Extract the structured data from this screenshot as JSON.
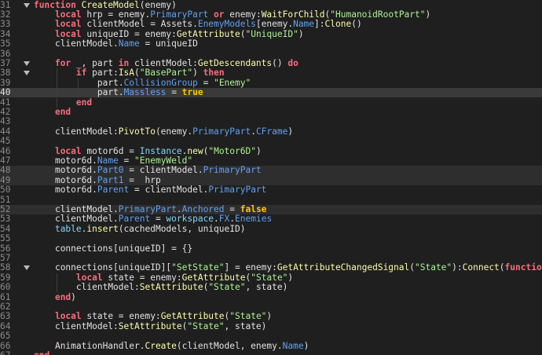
{
  "editor": {
    "lines": [
      {
        "num": "31",
        "fold": true,
        "state": "",
        "indent": 0,
        "tokens": [
          [
            "kw",
            "function"
          ],
          [
            "id",
            " "
          ],
          [
            "fn",
            "CreateModel"
          ],
          [
            "id",
            "(enemy)"
          ]
        ]
      },
      {
        "num": "32",
        "fold": false,
        "state": "",
        "indent": 1,
        "tokens": [
          [
            "kw",
            "local"
          ],
          [
            "id",
            " hrp = enemy."
          ],
          [
            "pr",
            "PrimaryPart"
          ],
          [
            "id",
            " "
          ],
          [
            "kw",
            "or"
          ],
          [
            "id",
            " enemy:"
          ],
          [
            "fn",
            "WaitForChild"
          ],
          [
            "id",
            "("
          ],
          [
            "st",
            "\"HumanoidRootPart\""
          ],
          [
            "id",
            ")"
          ]
        ]
      },
      {
        "num": "33",
        "fold": false,
        "state": "",
        "indent": 1,
        "tokens": [
          [
            "kw",
            "local"
          ],
          [
            "id",
            " clientModel = Assets."
          ],
          [
            "pr",
            "EnemyModels"
          ],
          [
            "id",
            "[enemy."
          ],
          [
            "pr",
            "Name"
          ],
          [
            "id",
            "]:"
          ],
          [
            "fn",
            "Clone"
          ],
          [
            "id",
            "()"
          ]
        ]
      },
      {
        "num": "34",
        "fold": false,
        "state": "",
        "indent": 1,
        "tokens": [
          [
            "kw",
            "local"
          ],
          [
            "id",
            " uniqueID = enemy:"
          ],
          [
            "fn",
            "GetAttribute"
          ],
          [
            "id",
            "("
          ],
          [
            "st",
            "\"UniqueID\""
          ],
          [
            "id",
            ")"
          ]
        ]
      },
      {
        "num": "35",
        "fold": false,
        "state": "",
        "indent": 1,
        "tokens": [
          [
            "id",
            "clientModel."
          ],
          [
            "pr",
            "Name"
          ],
          [
            "id",
            " = uniqueID"
          ]
        ]
      },
      {
        "num": "36",
        "fold": false,
        "state": "",
        "indent": 0,
        "tokens": []
      },
      {
        "num": "37",
        "fold": true,
        "state": "",
        "indent": 1,
        "tokens": [
          [
            "kw",
            "for"
          ],
          [
            "id",
            " _, part "
          ],
          [
            "kw",
            "in"
          ],
          [
            "id",
            " clientModel:"
          ],
          [
            "fn",
            "GetDescendants"
          ],
          [
            "id",
            "() "
          ],
          [
            "kw",
            "do"
          ]
        ]
      },
      {
        "num": "38",
        "fold": true,
        "state": "",
        "indent": 2,
        "tokens": [
          [
            "kw",
            "if"
          ],
          [
            "id",
            " part:"
          ],
          [
            "fn",
            "IsA"
          ],
          [
            "id",
            "("
          ],
          [
            "st",
            "\"BasePart\""
          ],
          [
            "id",
            ") "
          ],
          [
            "kw",
            "then"
          ]
        ]
      },
      {
        "num": "39",
        "fold": false,
        "state": "",
        "indent": 3,
        "tokens": [
          [
            "id",
            "part."
          ],
          [
            "pr",
            "CollisionGroup"
          ],
          [
            "id",
            " = "
          ],
          [
            "st",
            "\"Enemy\""
          ]
        ]
      },
      {
        "num": "40",
        "fold": false,
        "state": "cur",
        "indent": 3,
        "tokens": [
          [
            "id",
            "part."
          ],
          [
            "pr",
            "Massless"
          ],
          [
            "id",
            " = "
          ],
          [
            "bo",
            "true"
          ]
        ]
      },
      {
        "num": "41",
        "fold": false,
        "state": "",
        "indent": 2,
        "tokens": [
          [
            "kw",
            "end"
          ]
        ]
      },
      {
        "num": "42",
        "fold": false,
        "state": "",
        "indent": 1,
        "tokens": [
          [
            "kw",
            "end"
          ]
        ]
      },
      {
        "num": "43",
        "fold": false,
        "state": "",
        "indent": 0,
        "tokens": []
      },
      {
        "num": "44",
        "fold": false,
        "state": "",
        "indent": 1,
        "tokens": [
          [
            "id",
            "clientModel:"
          ],
          [
            "fn",
            "PivotTo"
          ],
          [
            "id",
            "(enemy."
          ],
          [
            "pr",
            "PrimaryPart"
          ],
          [
            "id",
            "."
          ],
          [
            "pr",
            "CFrame"
          ],
          [
            "id",
            ")"
          ]
        ]
      },
      {
        "num": "45",
        "fold": false,
        "state": "",
        "indent": 0,
        "tokens": []
      },
      {
        "num": "46",
        "fold": false,
        "state": "",
        "indent": 1,
        "tokens": [
          [
            "kw",
            "local"
          ],
          [
            "id",
            " motor6d = "
          ],
          [
            "bi",
            "Instance"
          ],
          [
            "id",
            "."
          ],
          [
            "fn",
            "new"
          ],
          [
            "id",
            "("
          ],
          [
            "st",
            "\"Motor6D\""
          ],
          [
            "id",
            ")"
          ]
        ]
      },
      {
        "num": "47",
        "fold": false,
        "state": "",
        "indent": 1,
        "tokens": [
          [
            "id",
            "motor6d."
          ],
          [
            "pr",
            "Name"
          ],
          [
            "id",
            " = "
          ],
          [
            "st",
            "\"EnemyWeld\""
          ]
        ]
      },
      {
        "num": "48",
        "fold": false,
        "state": "hl",
        "indent": 1,
        "tokens": [
          [
            "id",
            "motor6d."
          ],
          [
            "pr",
            "Part0"
          ],
          [
            "id",
            " = clientModel."
          ],
          [
            "pr",
            "PrimaryPart"
          ]
        ]
      },
      {
        "num": "49",
        "fold": false,
        "state": "hl",
        "indent": 1,
        "tokens": [
          [
            "id",
            "motor6d."
          ],
          [
            "pr",
            "Part1"
          ],
          [
            "id",
            " =  hrp"
          ]
        ]
      },
      {
        "num": "50",
        "fold": false,
        "state": "",
        "indent": 1,
        "tokens": [
          [
            "id",
            "motor6d."
          ],
          [
            "pr",
            "Parent"
          ],
          [
            "id",
            " = clientModel."
          ],
          [
            "pr",
            "PrimaryPart"
          ]
        ]
      },
      {
        "num": "51",
        "fold": false,
        "state": "",
        "indent": 0,
        "tokens": []
      },
      {
        "num": "52",
        "fold": false,
        "state": "hl",
        "indent": 1,
        "tokens": [
          [
            "id",
            "clientModel."
          ],
          [
            "pr",
            "PrimaryPart"
          ],
          [
            "id",
            "."
          ],
          [
            "pr",
            "Anchored"
          ],
          [
            "id",
            " = "
          ],
          [
            "bo",
            "false"
          ]
        ]
      },
      {
        "num": "53",
        "fold": false,
        "state": "",
        "indent": 1,
        "tokens": [
          [
            "id",
            "clientModel."
          ],
          [
            "pr",
            "Parent"
          ],
          [
            "id",
            " = "
          ],
          [
            "bi",
            "workspace"
          ],
          [
            "id",
            "."
          ],
          [
            "pr",
            "FX"
          ],
          [
            "id",
            "."
          ],
          [
            "pr",
            "Enemies"
          ]
        ]
      },
      {
        "num": "54",
        "fold": false,
        "state": "",
        "indent": 1,
        "tokens": [
          [
            "bi",
            "table"
          ],
          [
            "id",
            "."
          ],
          [
            "fn",
            "insert"
          ],
          [
            "id",
            "(cachedModels, uniqueID)"
          ]
        ]
      },
      {
        "num": "55",
        "fold": false,
        "state": "",
        "indent": 0,
        "tokens": []
      },
      {
        "num": "56",
        "fold": false,
        "state": "",
        "indent": 1,
        "tokens": [
          [
            "id",
            "connections[uniqueID] = {}"
          ]
        ]
      },
      {
        "num": "57",
        "fold": false,
        "state": "",
        "indent": 0,
        "tokens": []
      },
      {
        "num": "58",
        "fold": true,
        "state": "",
        "indent": 1,
        "tokens": [
          [
            "id",
            "connections[uniqueID]["
          ],
          [
            "st",
            "\"SetState\""
          ],
          [
            "id",
            "] = enemy:"
          ],
          [
            "fn",
            "GetAttributeChangedSignal"
          ],
          [
            "id",
            "("
          ],
          [
            "st",
            "\"State\""
          ],
          [
            "id",
            "):"
          ],
          [
            "fn",
            "Connect"
          ],
          [
            "id",
            "("
          ],
          [
            "kw",
            "function"
          ],
          [
            "id",
            "()"
          ]
        ]
      },
      {
        "num": "59",
        "fold": false,
        "state": "",
        "indent": 2,
        "tokens": [
          [
            "kw",
            "local"
          ],
          [
            "id",
            " state = enemy:"
          ],
          [
            "fn",
            "GetAttribute"
          ],
          [
            "id",
            "("
          ],
          [
            "st",
            "\"State\""
          ],
          [
            "id",
            ")"
          ]
        ]
      },
      {
        "num": "60",
        "fold": false,
        "state": "",
        "indent": 2,
        "tokens": [
          [
            "id",
            "clientModel:"
          ],
          [
            "fn",
            "SetAttribute"
          ],
          [
            "id",
            "("
          ],
          [
            "st",
            "\"State\""
          ],
          [
            "id",
            ", state)"
          ]
        ]
      },
      {
        "num": "61",
        "fold": false,
        "state": "",
        "indent": 1,
        "tokens": [
          [
            "kw",
            "end"
          ],
          [
            "id",
            ")"
          ]
        ]
      },
      {
        "num": "62",
        "fold": false,
        "state": "",
        "indent": 0,
        "tokens": []
      },
      {
        "num": "63",
        "fold": false,
        "state": "",
        "indent": 1,
        "tokens": [
          [
            "kw",
            "local"
          ],
          [
            "id",
            " state = enemy:"
          ],
          [
            "fn",
            "GetAttribute"
          ],
          [
            "id",
            "("
          ],
          [
            "st",
            "\"State\""
          ],
          [
            "id",
            ")"
          ]
        ]
      },
      {
        "num": "64",
        "fold": false,
        "state": "",
        "indent": 1,
        "tokens": [
          [
            "id",
            "clientModel:"
          ],
          [
            "fn",
            "SetAttribute"
          ],
          [
            "id",
            "("
          ],
          [
            "st",
            "\"State\""
          ],
          [
            "id",
            ", state)"
          ]
        ]
      },
      {
        "num": "65",
        "fold": false,
        "state": "",
        "indent": 0,
        "tokens": []
      },
      {
        "num": "66",
        "fold": false,
        "state": "",
        "indent": 1,
        "tokens": [
          [
            "id",
            "AnimationHandler."
          ],
          [
            "fn",
            "Create"
          ],
          [
            "id",
            "(clientModel, enemy."
          ],
          [
            "pr",
            "Name"
          ],
          [
            "id",
            ")"
          ]
        ]
      },
      {
        "num": "67",
        "fold": false,
        "state": "",
        "indent": 0,
        "tokens": [
          [
            "kw",
            "end"
          ]
        ]
      }
    ]
  }
}
